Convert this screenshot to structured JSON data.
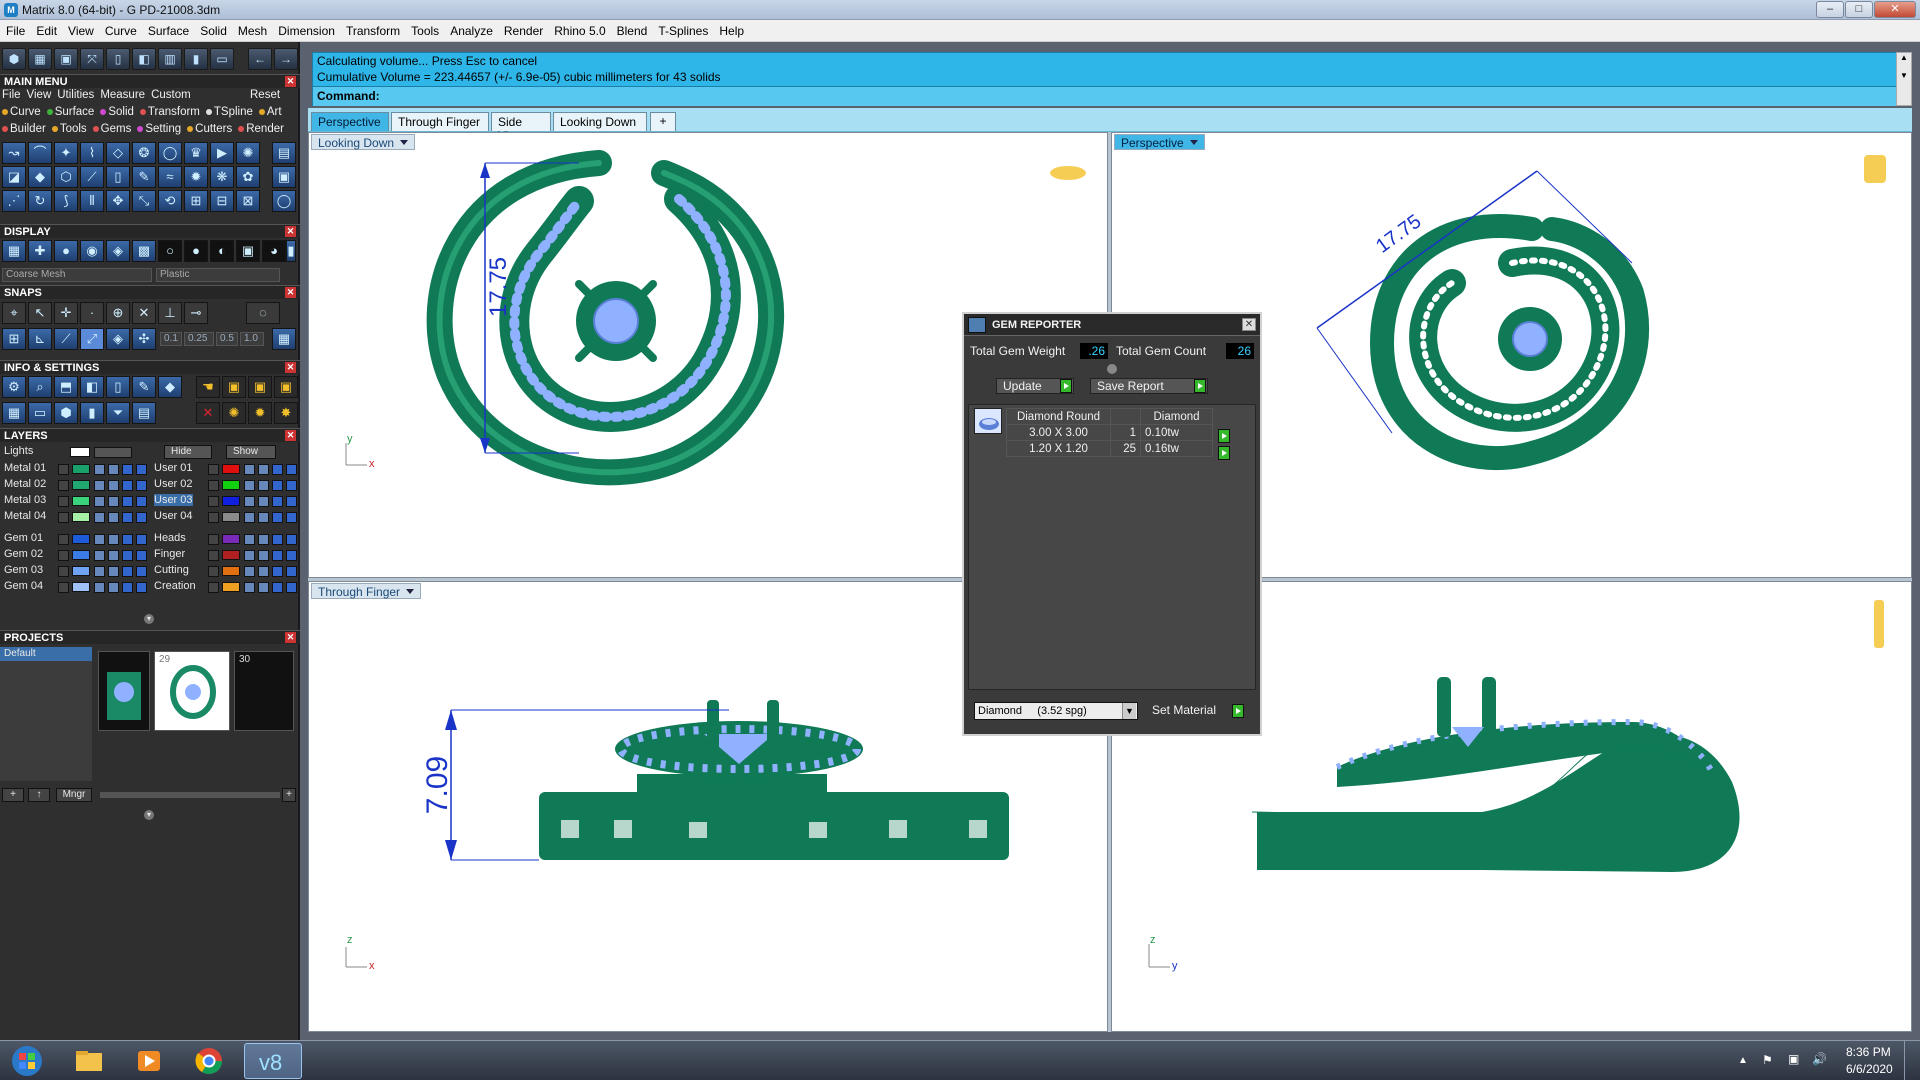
{
  "window": {
    "title": "Matrix 8.0 (64-bit) - G PD-21008.3dm",
    "controls": [
      "–",
      "□",
      "✕"
    ]
  },
  "menubar": [
    "File",
    "Edit",
    "View",
    "Curve",
    "Surface",
    "Solid",
    "Mesh",
    "Dimension",
    "Transform",
    "Tools",
    "Analyze",
    "Render",
    "Rhino 5.0",
    "Blend",
    "T-Splines",
    "Help"
  ],
  "left": {
    "main_menu": {
      "header": "MAIN MENU",
      "line1": [
        "File",
        "View",
        "Utilities",
        "Measure",
        "Custom"
      ],
      "reset": "Reset",
      "line2": [
        "Curve",
        "Surface",
        "Solid",
        "Transform",
        "TSpline",
        "Art"
      ],
      "line3": [
        "Builder",
        "Tools",
        "Gems",
        "Setting",
        "Cutters",
        "Render"
      ]
    },
    "display": {
      "header": "DISPLAY",
      "mesh": "Coarse Mesh",
      "material": "Plastic"
    },
    "snaps": {
      "header": "SNAPS",
      "values": [
        "0.1",
        "0.25",
        "0.5",
        "1.0"
      ]
    },
    "info": {
      "header": "INFO & SETTINGS"
    },
    "layers": {
      "header": "LAYERS",
      "lights": "Lights",
      "hide": "Hide",
      "show": "Show",
      "left": [
        {
          "name": "Metal 01",
          "color": "#1aa06a"
        },
        {
          "name": "Metal 02",
          "color": "#20a870"
        },
        {
          "name": "Metal 03",
          "color": "#3ad37c"
        },
        {
          "name": "Metal 04",
          "color": "#a6f0a6"
        },
        {
          "name": "Gem 01",
          "color": "#1d5bd8"
        },
        {
          "name": "Gem 02",
          "color": "#3b7be8"
        },
        {
          "name": "Gem 03",
          "color": "#6fa2f2"
        },
        {
          "name": "Gem 04",
          "color": "#9fc3f7"
        }
      ],
      "right": [
        {
          "name": "User 01",
          "color": "#e01010"
        },
        {
          "name": "User 02",
          "color": "#10d010"
        },
        {
          "name": "User 03",
          "color": "#1020e0"
        },
        {
          "name": "User 04",
          "color": "#8a8a8a"
        },
        {
          "name": "Heads",
          "color": "#7a2ab8"
        },
        {
          "name": "Finger",
          "color": "#b02020"
        },
        {
          "name": "Cutting",
          "color": "#e07010"
        },
        {
          "name": "Creation",
          "color": "#f0a020"
        }
      ]
    },
    "projects": {
      "header": "PROJECTS",
      "default": "Default",
      "thumb2": "29",
      "thumb3": "30",
      "mngr": "Mngr"
    }
  },
  "command": {
    "line1": "Calculating volume... Press Esc to cancel",
    "line2": "Cumulative Volume = 223.44657 (+/- 6.9e-05) cubic millimeters for 43 solids",
    "prompt": "Command:"
  },
  "tabs": [
    "Perspective",
    "Through Finger",
    "Side View",
    "Looking Down",
    "+"
  ],
  "viewports": {
    "top_left": {
      "label": "Looking Down",
      "dimension": "17.75",
      "axis1": "y",
      "axis2": "x"
    },
    "top_right": {
      "label": "Perspective",
      "dimension": "17.75"
    },
    "bottom_left": {
      "label": "Through Finger",
      "dimension": "7.09",
      "axis1": "z",
      "axis2": "x"
    },
    "bottom_right": {
      "label": "",
      "axis1": "z",
      "axis2": "y"
    }
  },
  "gem_reporter": {
    "title": "GEM REPORTER",
    "weight_label": "Total Gem Weight",
    "weight_value": ".26",
    "count_label": "Total Gem Count",
    "count_value": "26",
    "update": "Update",
    "save_report": "Save Report",
    "headers": [
      "Diamond Round",
      "",
      "Diamond"
    ],
    "rows": [
      {
        "size": "3.00 X 3.00",
        "count": "1",
        "weight": "0.10tw"
      },
      {
        "size": "1.20 X 1.20",
        "count": "25",
        "weight": "0.16tw"
      }
    ],
    "material": "Diamond     (3.52 spg)",
    "set_material": "Set Material"
  },
  "taskbar": {
    "time": "8:36 PM",
    "date": "6/6/2020"
  },
  "colors": {
    "metal": "#0f7a55",
    "gem": "#8fb1ff",
    "dimension": "#1a34c8"
  }
}
